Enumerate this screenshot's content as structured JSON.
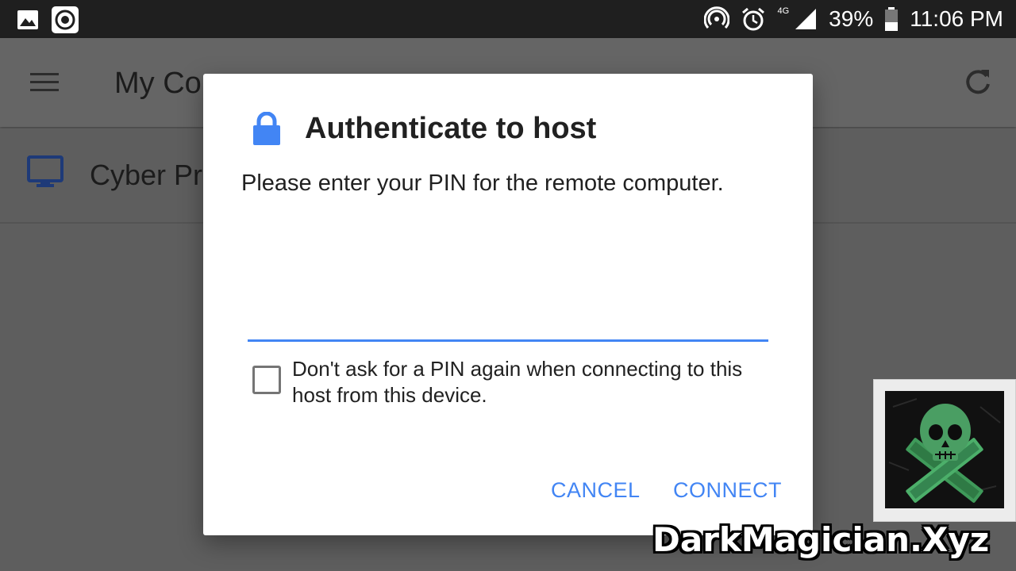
{
  "status_bar": {
    "network": "4G",
    "battery": "39%",
    "time": "11:06 PM",
    "icons": [
      "image-icon",
      "record-icon",
      "hotspot-icon",
      "alarm-icon",
      "signal-icon",
      "battery-icon"
    ]
  },
  "app_bar": {
    "title": "My Co",
    "icons": [
      "menu-icon",
      "refresh-icon"
    ]
  },
  "host_list": {
    "items": [
      {
        "name": "Cyber Pri",
        "icon": "monitor-icon"
      }
    ]
  },
  "dialog": {
    "title": "Authenticate to host",
    "icon": "lock-icon",
    "message": "Please enter your PIN for the remote computer.",
    "pin_input": {
      "value": "",
      "placeholder": ""
    },
    "checkbox": {
      "label": "Don't ask for a PIN again when connecting to this host from this device.",
      "checked": false
    },
    "buttons": {
      "cancel": "CANCEL",
      "connect": "CONNECT"
    }
  },
  "watermark": {
    "text": "DarkMagician.Xyz",
    "image": "skull-crossbones-logo"
  },
  "colors": {
    "accent": "#4285f4",
    "scrim": "#5e5e5e",
    "status_bar": "#1f1f1f",
    "dialog_bg": "#ffffff",
    "text_primary": "#212121"
  }
}
